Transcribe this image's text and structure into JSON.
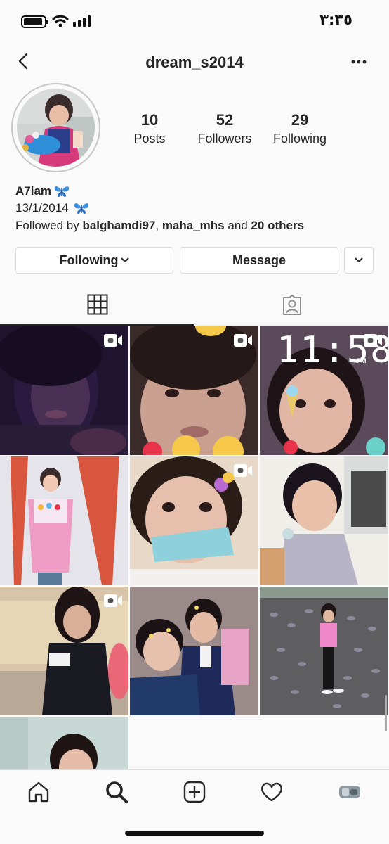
{
  "status_bar": {
    "time": "٣:٣٥"
  },
  "header": {
    "username": "dream_s2014"
  },
  "profile": {
    "stats": [
      {
        "count": "10",
        "label": "Posts"
      },
      {
        "count": "52",
        "label": "Followers"
      },
      {
        "count": "29",
        "label": "Following"
      }
    ],
    "name": "A7lam",
    "bio_line": "13/1/2014",
    "followed_by": {
      "prefix": "Followed by ",
      "user1": "balghamdi97",
      "sep": ", ",
      "user2": "maha_mhs",
      "middle": " and ",
      "others": "20 others"
    }
  },
  "buttons": {
    "following": "Following",
    "message": "Message"
  },
  "tabs": [
    {
      "icon": "grid-icon",
      "selected": true
    },
    {
      "icon": "tagged-icon",
      "selected": false
    }
  ],
  "posts": [
    {
      "video": true
    },
    {
      "video": true
    },
    {
      "video": true,
      "overlay_time": "11:58",
      "overlay_suffix": "PM"
    },
    {
      "video": false
    },
    {
      "video": true
    },
    {
      "video": false
    },
    {
      "video": true
    },
    {
      "video": false
    },
    {
      "video": false
    },
    {
      "video": false
    }
  ],
  "bottom_nav": [
    "home-icon",
    "search-icon",
    "new-post-icon",
    "activity-icon",
    "profile-icon"
  ],
  "colors": {
    "text": "#262626",
    "border": "#dbdbdb",
    "background": "#fafafa",
    "butterfly": "#3d8fe0"
  }
}
